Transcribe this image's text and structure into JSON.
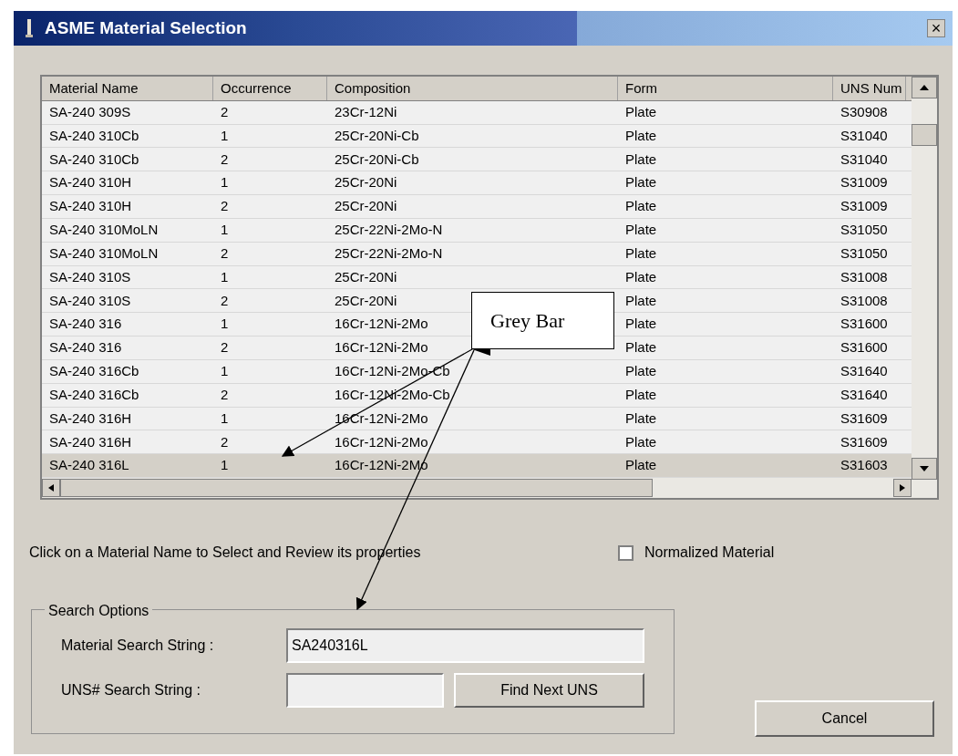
{
  "window": {
    "title": "ASME Material Selection",
    "close": "×"
  },
  "table": {
    "columns": [
      "Material Name",
      "Occurrence",
      "Composition",
      "Form",
      "UNS Num"
    ],
    "rows": [
      {
        "cells": [
          "SA-240 309S",
          "2",
          "23Cr-12Ni",
          "Plate",
          "S30908"
        ],
        "selected": false
      },
      {
        "cells": [
          "SA-240 310Cb",
          "1",
          "25Cr-20Ni-Cb",
          "Plate",
          "S31040"
        ],
        "selected": false
      },
      {
        "cells": [
          "SA-240 310Cb",
          "2",
          "25Cr-20Ni-Cb",
          "Plate",
          "S31040"
        ],
        "selected": false
      },
      {
        "cells": [
          "SA-240 310H",
          "1",
          "25Cr-20Ni",
          "Plate",
          "S31009"
        ],
        "selected": false
      },
      {
        "cells": [
          "SA-240 310H",
          "2",
          "25Cr-20Ni",
          "Plate",
          "S31009"
        ],
        "selected": false
      },
      {
        "cells": [
          "SA-240 310MoLN",
          "1",
          "25Cr-22Ni-2Mo-N",
          "Plate",
          "S31050"
        ],
        "selected": false
      },
      {
        "cells": [
          "SA-240 310MoLN",
          "2",
          "25Cr-22Ni-2Mo-N",
          "Plate",
          "S31050"
        ],
        "selected": false
      },
      {
        "cells": [
          "SA-240 310S",
          "1",
          "25Cr-20Ni",
          "Plate",
          "S31008"
        ],
        "selected": false
      },
      {
        "cells": [
          "SA-240 310S",
          "2",
          "25Cr-20Ni",
          "Plate",
          "S31008"
        ],
        "selected": false
      },
      {
        "cells": [
          "SA-240 316",
          "1",
          "16Cr-12Ni-2Mo",
          "Plate",
          "S31600"
        ],
        "selected": false
      },
      {
        "cells": [
          "SA-240 316",
          "2",
          "16Cr-12Ni-2Mo",
          "Plate",
          "S31600"
        ],
        "selected": false
      },
      {
        "cells": [
          "SA-240 316Cb",
          "1",
          "16Cr-12Ni-2Mo-Cb",
          "Plate",
          "S31640"
        ],
        "selected": false
      },
      {
        "cells": [
          "SA-240 316Cb",
          "2",
          "16Cr-12Ni-2Mo-Cb",
          "Plate",
          "S31640"
        ],
        "selected": false
      },
      {
        "cells": [
          "SA-240 316H",
          "1",
          "16Cr-12Ni-2Mo",
          "Plate",
          "S31609"
        ],
        "selected": false
      },
      {
        "cells": [
          "SA-240 316H",
          "2",
          "16Cr-12Ni-2Mo",
          "Plate",
          "S31609"
        ],
        "selected": false
      },
      {
        "cells": [
          "SA-240 316L",
          "1",
          "16Cr-12Ni-2Mo",
          "Plate",
          "S31603"
        ],
        "selected": true
      }
    ]
  },
  "hint": "Click on a Material Name to Select and Review its properties",
  "normalized": {
    "label": "Normalized Material",
    "checked": false
  },
  "search": {
    "title": "Search Options",
    "material_label": "Material Search String :",
    "material_value": "SA240316L",
    "uns_label": "UNS# Search String :",
    "find_button": "Find Next UNS"
  },
  "cancel": "Cancel",
  "callout": {
    "text": "Grey Bar"
  }
}
